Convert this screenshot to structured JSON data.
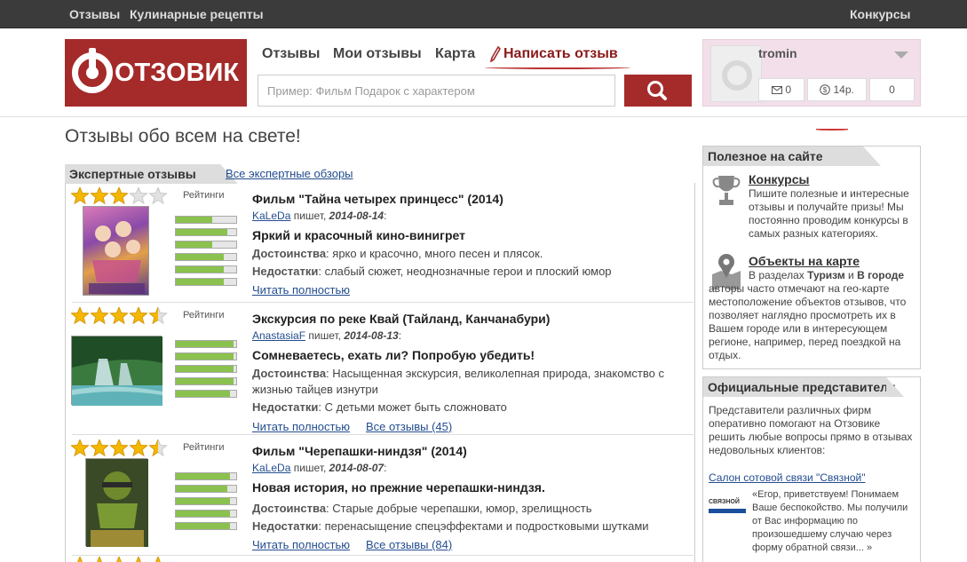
{
  "topbar": {
    "reviews": "Отзывы",
    "recipes": "Кулинарные рецепты",
    "contests": "Конкурсы"
  },
  "logo": {
    "text": "ОТЗОВИК"
  },
  "nav": {
    "reviews": "Отзывы",
    "my_reviews": "Мои отзывы",
    "map": "Карта",
    "write": "Написать отзыв"
  },
  "search": {
    "placeholder": "Пример: Фильм Подарок с характером"
  },
  "user": {
    "name": "tromin",
    "messages": "0",
    "money": "14р.",
    "third": "0"
  },
  "page_title": "Отзывы обо всем на свете!",
  "expert": {
    "tab": "Экспертные отзывы",
    "all_link": "Все экспертные обзоры"
  },
  "labels": {
    "ratings": "Рейтинги",
    "pros": "Достоинства",
    "cons": "Недостатки",
    "read_full": "Читать полностью",
    "writes": "пишет,"
  },
  "reviews": [
    {
      "title": "Фильм \"Тайна четырех принцесс\" (2014)",
      "author": "KaLeDa",
      "date": "2014-08-14",
      "headline": "Яркий и красочный кино-винигрет",
      "pros": "ярко и красочно, много песен и плясок.",
      "cons": "слабый сюжет, неоднозначные герои и плоский юмор",
      "all_link": "",
      "star_rating": 3,
      "ratings": [
        0.6,
        0.85,
        0.6,
        0.8,
        0.8,
        0.8
      ]
    },
    {
      "title": "Экскурсия по реке Квай (Тайланд, Канчанабури)",
      "author": "AnastasiaF",
      "date": "2014-08-13",
      "headline": "Сомневаетесь, ехать ли? Попробую убедить!",
      "pros": "Насыщенная экскурсия, великолепная природа, знакомство с жизнью тайцев изнутри",
      "cons": "С детьми может быть сложновато",
      "all_link": "Все отзывы (45)",
      "star_rating": 4.5,
      "ratings": [
        0.95,
        0.95,
        0.95,
        0.95,
        0.9
      ]
    },
    {
      "title": "Фильм \"Черепашки-ниндзя\" (2014)",
      "author": "KaLeDa",
      "date": "2014-08-07",
      "headline": "Новая история, но прежние черепашки-ниндзя.",
      "pros": "Старые добрые черепашки, юмор, зрелищность",
      "cons": "перенасыщение спецэффектами и подростковыми шутками",
      "all_link": "Все отзывы (84)",
      "star_rating": 4.5,
      "ratings": [
        0.9,
        0.85,
        0.9,
        0.9,
        0.9
      ]
    }
  ],
  "sidebar": {
    "useful_title": "Полезное на сайте",
    "contests_title": "Конкурсы",
    "contests_text": "Пишите полезные и интересные отзывы и получайте призы! Мы постоянно проводим конкурсы в самых разных категориях.",
    "map_title": "Объекты на карте",
    "map_text_1": "В разделах ",
    "map_bold_1": "Туризм",
    "map_text_2": " и ",
    "map_bold_2": "В городе",
    "map_text_3": " авторы часто отмечают на гео-карте местоположение объектов отзывов, что позволяет наглядно просмотреть их в Вашем городе или в интересующем регионе, например, перед поездкой на отдых.",
    "official_title": "Официальные представители",
    "official_text": "Представители различных фирм оперативно помогают на Отзовике решить любые вопросы прямо в отзывах недовольных клиентов:",
    "rep_link": "Салон сотовой связи \"Связной\"",
    "rep_logo": "СВЯЗНОЙ",
    "rep_quote": "«Егор, приветствуем! Понимаем Ваше беспокойство. Мы получили от Вас информацию по произошедшему случаю через форму обратной связи... »"
  },
  "colors": {
    "brand": "#a52a2a",
    "link": "#234d8f",
    "bar_fill": "#8bc14e",
    "star": "#f5b800"
  }
}
